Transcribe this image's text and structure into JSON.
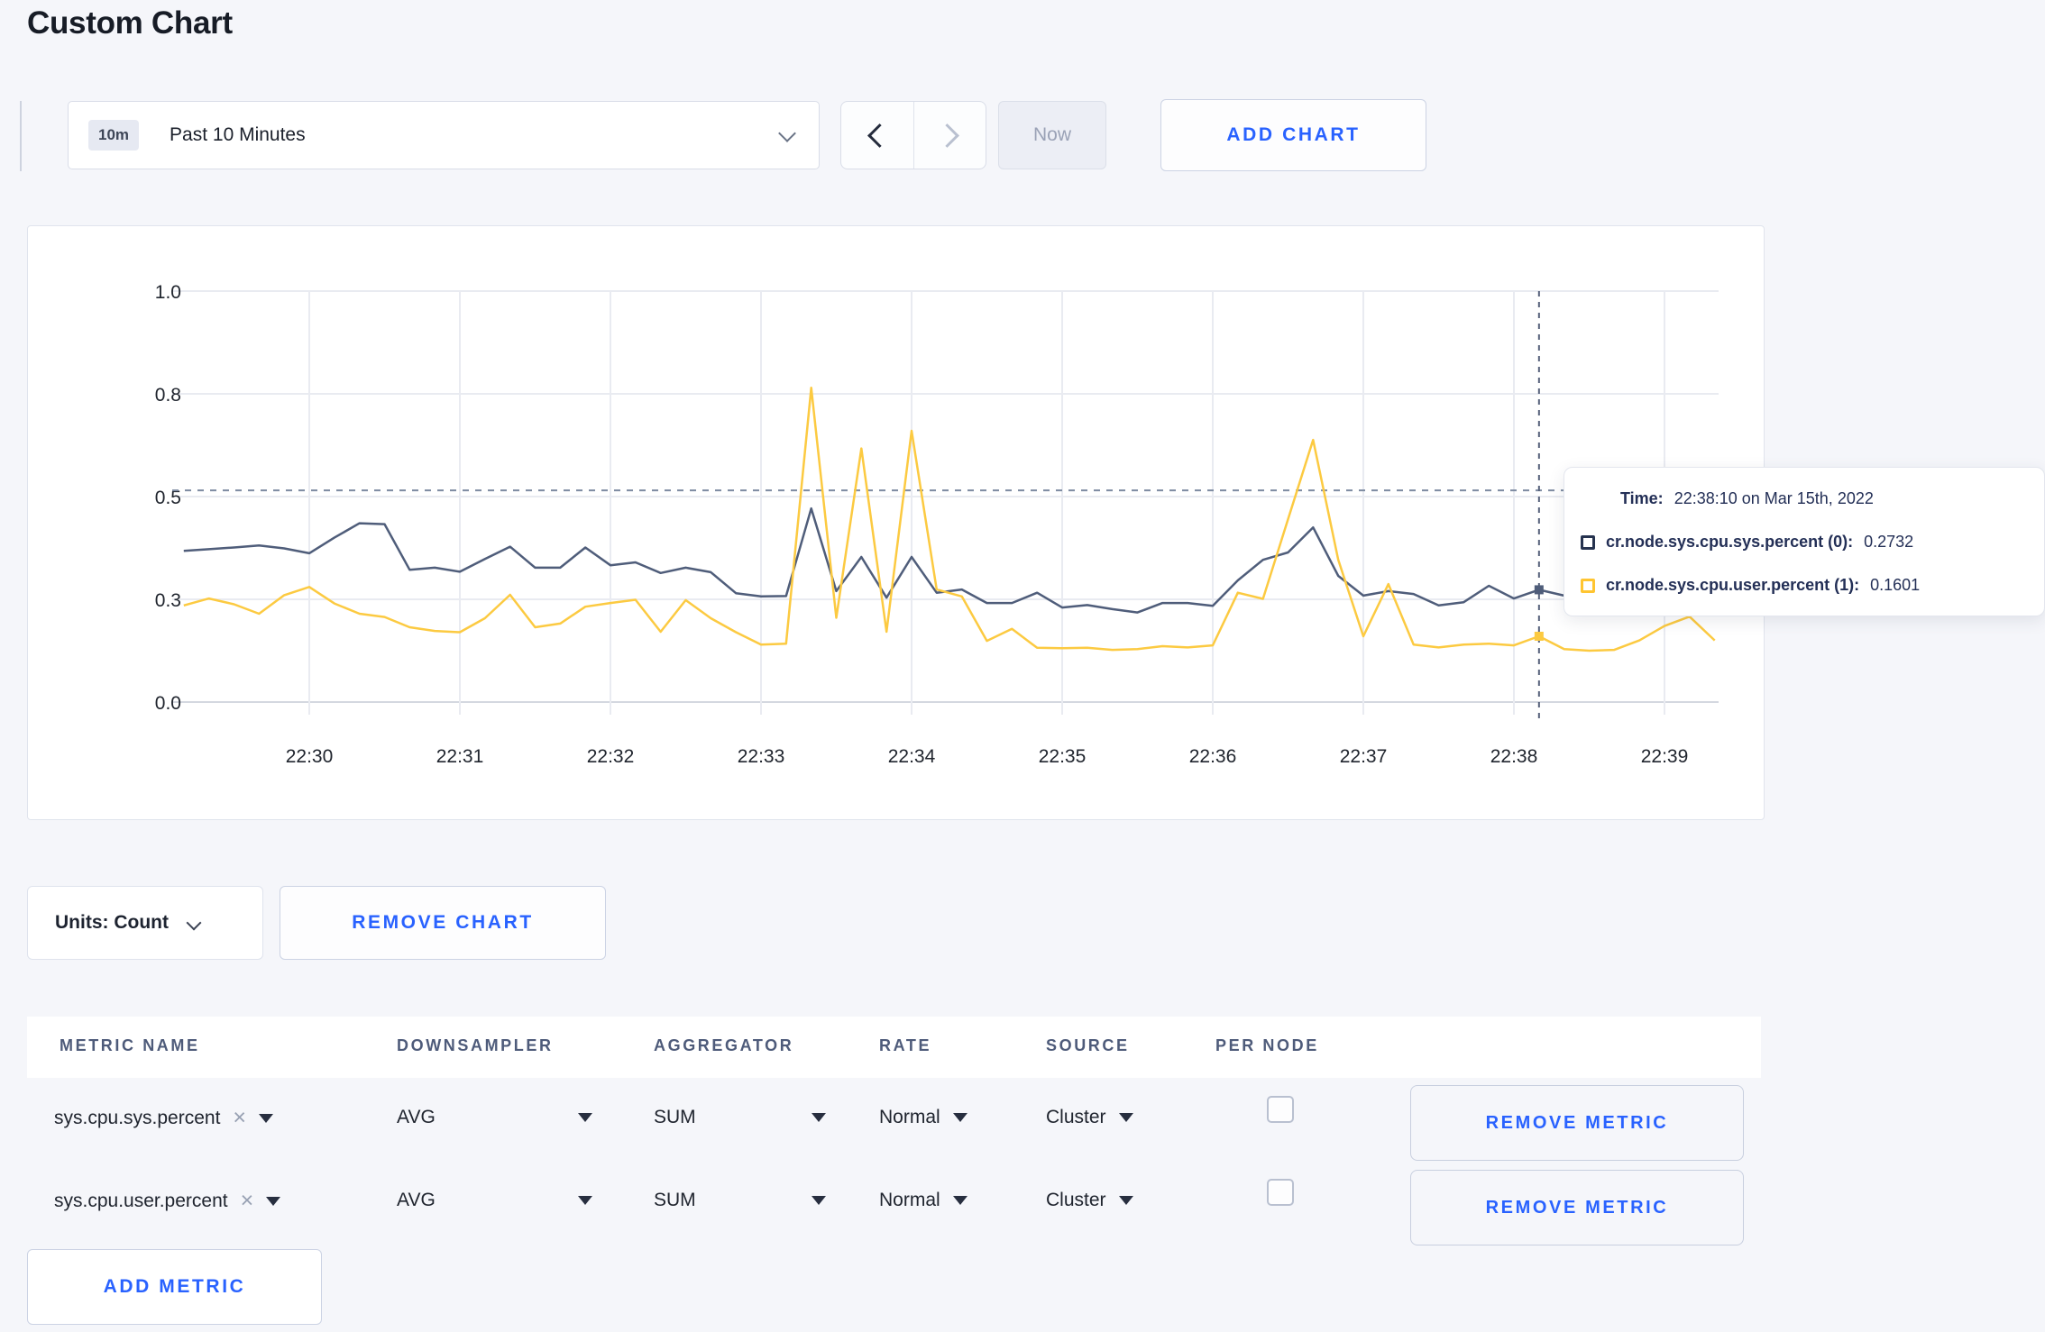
{
  "page": {
    "title": "Custom Chart",
    "accent_blue": "#2962ff",
    "background": "#f5f6fa"
  },
  "toolbar": {
    "range_badge": "10m",
    "range_label": "Past 10 Minutes",
    "now_label": "Now",
    "add_chart_label": "ADD CHART"
  },
  "chart_controls": {
    "units_label": "Units: Count",
    "remove_chart_label": "REMOVE CHART"
  },
  "chart_data": {
    "type": "line",
    "title": "",
    "xlabel": "",
    "ylabel": "",
    "ylim": [
      0,
      1
    ],
    "grid": true,
    "x_ticks": [
      "22:30",
      "22:31",
      "22:32",
      "22:33",
      "22:34",
      "22:35",
      "22:36",
      "22:37",
      "22:38",
      "22:39"
    ],
    "y_ticks": [
      {
        "label": "0.0",
        "value": 0
      },
      {
        "label": "0.3",
        "value": 0.25
      },
      {
        "label": "0.5",
        "value": 0.5
      },
      {
        "label": "0.8",
        "value": 0.75
      },
      {
        "label": "1.0",
        "value": 1.0
      }
    ],
    "start_time": "22:29:10",
    "interval_seconds": 10,
    "guideline_value": 0.515,
    "crosshair_index": 54,
    "crosshair_time": "22:38:10",
    "series": [
      {
        "name": "cr.node.sys.cpu.sys.percent (0)",
        "color": "#4f5d7a",
        "values": [
          0.368,
          0.372,
          0.376,
          0.381,
          0.374,
          0.362,
          0.4,
          0.435,
          0.433,
          0.322,
          0.327,
          0.317,
          0.348,
          0.378,
          0.327,
          0.327,
          0.376,
          0.333,
          0.34,
          0.314,
          0.327,
          0.316,
          0.265,
          0.257,
          0.258,
          0.471,
          0.27,
          0.353,
          0.254,
          0.353,
          0.266,
          0.274,
          0.241,
          0.241,
          0.266,
          0.23,
          0.236,
          0.226,
          0.218,
          0.241,
          0.241,
          0.234,
          0.296,
          0.346,
          0.364,
          0.425,
          0.307,
          0.259,
          0.27,
          0.263,
          0.235,
          0.243,
          0.283,
          0.252,
          0.2732,
          0.259,
          0.263,
          0.271,
          0.282,
          0.293,
          0.301,
          0.306
        ]
      },
      {
        "name": "cr.node.sys.cpu.user.percent (1)",
        "color": "#fcca41",
        "values": [
          0.235,
          0.252,
          0.238,
          0.215,
          0.26,
          0.28,
          0.24,
          0.215,
          0.207,
          0.182,
          0.173,
          0.17,
          0.204,
          0.261,
          0.182,
          0.191,
          0.232,
          0.241,
          0.249,
          0.171,
          0.248,
          0.204,
          0.17,
          0.14,
          0.142,
          0.765,
          0.205,
          0.617,
          0.171,
          0.66,
          0.274,
          0.257,
          0.149,
          0.178,
          0.132,
          0.131,
          0.132,
          0.127,
          0.129,
          0.136,
          0.133,
          0.138,
          0.266,
          0.251,
          0.445,
          0.638,
          0.346,
          0.16,
          0.287,
          0.14,
          0.133,
          0.14,
          0.142,
          0.138,
          0.1601,
          0.129,
          0.125,
          0.127,
          0.15,
          0.185,
          0.208,
          0.15
        ]
      }
    ]
  },
  "tooltip": {
    "time_label": "Time:",
    "time_value": "22:38:10 on Mar 15th, 2022",
    "rows": [
      {
        "label": "cr.node.sys.cpu.sys.percent (0):",
        "value": "0.2732",
        "swatch_color": "#26334f"
      },
      {
        "label": "cr.node.sys.cpu.user.percent (1):",
        "value": "0.1601",
        "swatch_color": "#ffc531"
      }
    ]
  },
  "metrics_table": {
    "headers": [
      "METRIC NAME",
      "DOWNSAMPLER",
      "AGGREGATOR",
      "RATE",
      "SOURCE",
      "PER NODE"
    ],
    "rows": [
      {
        "metric": "sys.cpu.sys.percent",
        "downsampler": "AVG",
        "aggregator": "SUM",
        "rate": "Normal",
        "source": "Cluster",
        "per_node": false,
        "remove_label": "REMOVE METRIC"
      },
      {
        "metric": "sys.cpu.user.percent",
        "downsampler": "AVG",
        "aggregator": "SUM",
        "rate": "Normal",
        "source": "Cluster",
        "per_node": false,
        "remove_label": "REMOVE METRIC"
      }
    ],
    "add_metric_label": "ADD METRIC"
  }
}
